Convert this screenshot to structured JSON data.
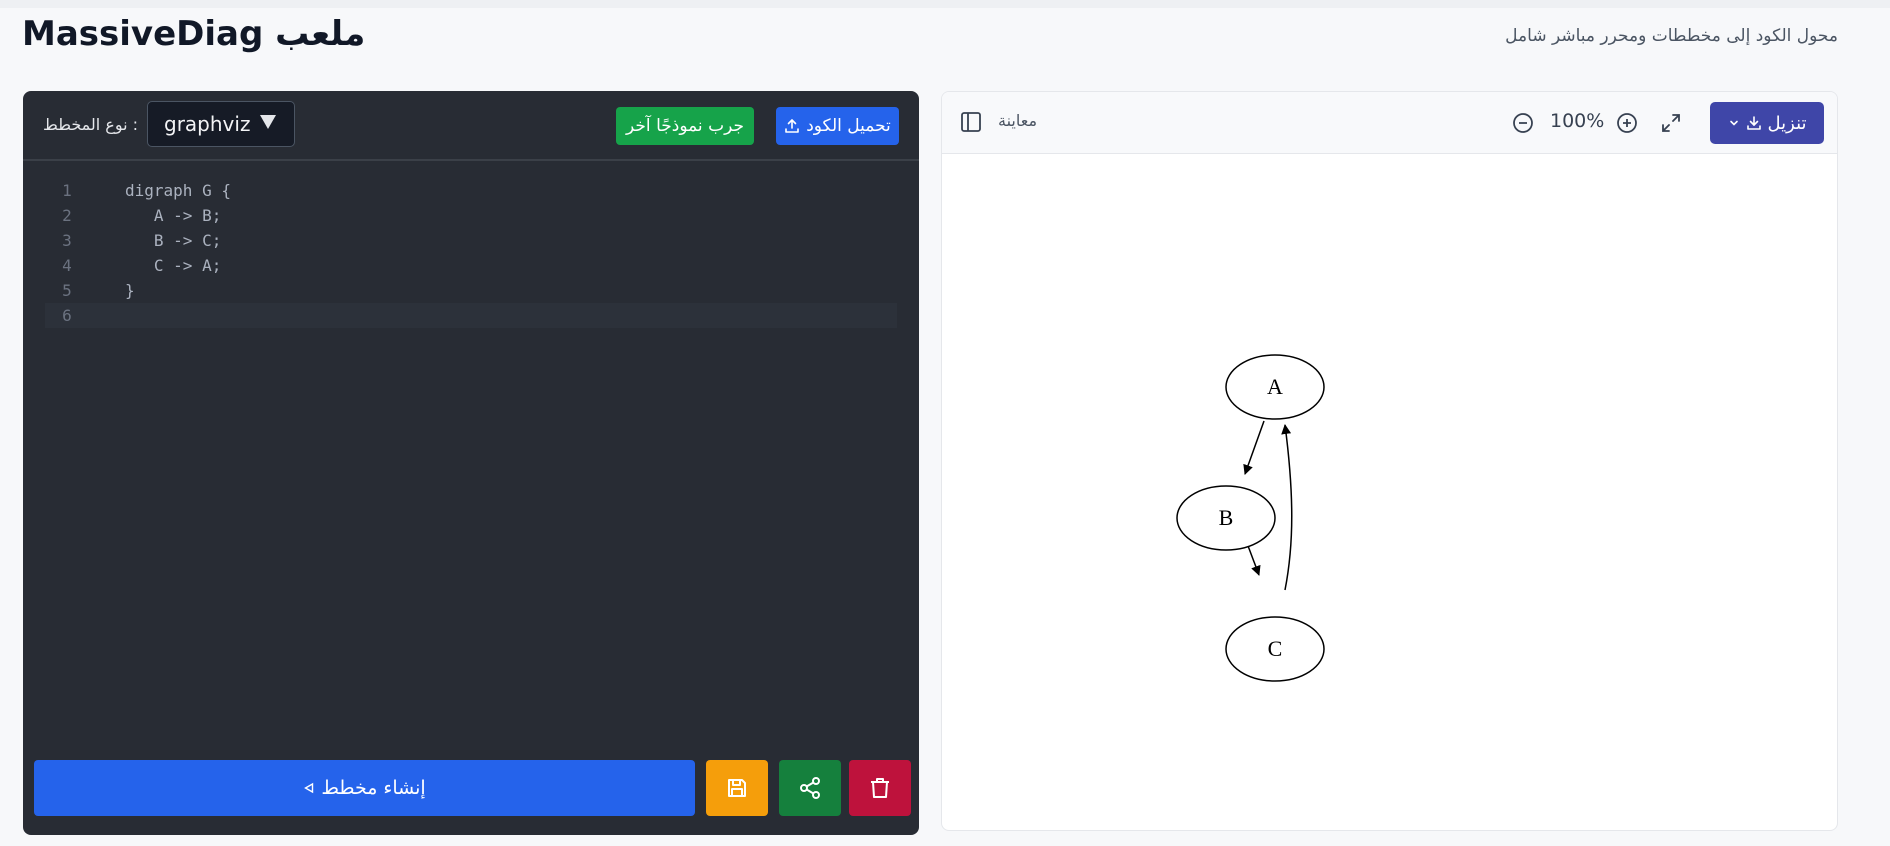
{
  "header": {
    "title": "MassiveDiag ملعب",
    "subtitle": "محول الكود إلى مخططات ومحرر مباشر شامل"
  },
  "editor": {
    "diagram_type_label": ": نوع المخطط",
    "diagram_type_value": "graphviz",
    "sample_button": "جرب نموذجًا آخر",
    "upload_button": "تحميل الكود",
    "lines": [
      {
        "n": "1",
        "text": "digraph G {"
      },
      {
        "n": "2",
        "text": "   A -> B;"
      },
      {
        "n": "3",
        "text": "   B -> C;"
      },
      {
        "n": "4",
        "text": "   C -> A;"
      },
      {
        "n": "5",
        "text": "}"
      },
      {
        "n": "6",
        "text": ""
      }
    ],
    "generate_button": "إنشاء مخطط"
  },
  "preview": {
    "label": "معاينة",
    "zoom": "100%",
    "download_button": "تنزيل",
    "nodes": [
      "A",
      "B",
      "C"
    ]
  },
  "colors": {
    "primary": "#2563eb",
    "success": "#16a34a",
    "warning": "#f59e0b",
    "danger": "#be123c",
    "download": "#3f46a8",
    "editor_bg": "#282c34"
  }
}
